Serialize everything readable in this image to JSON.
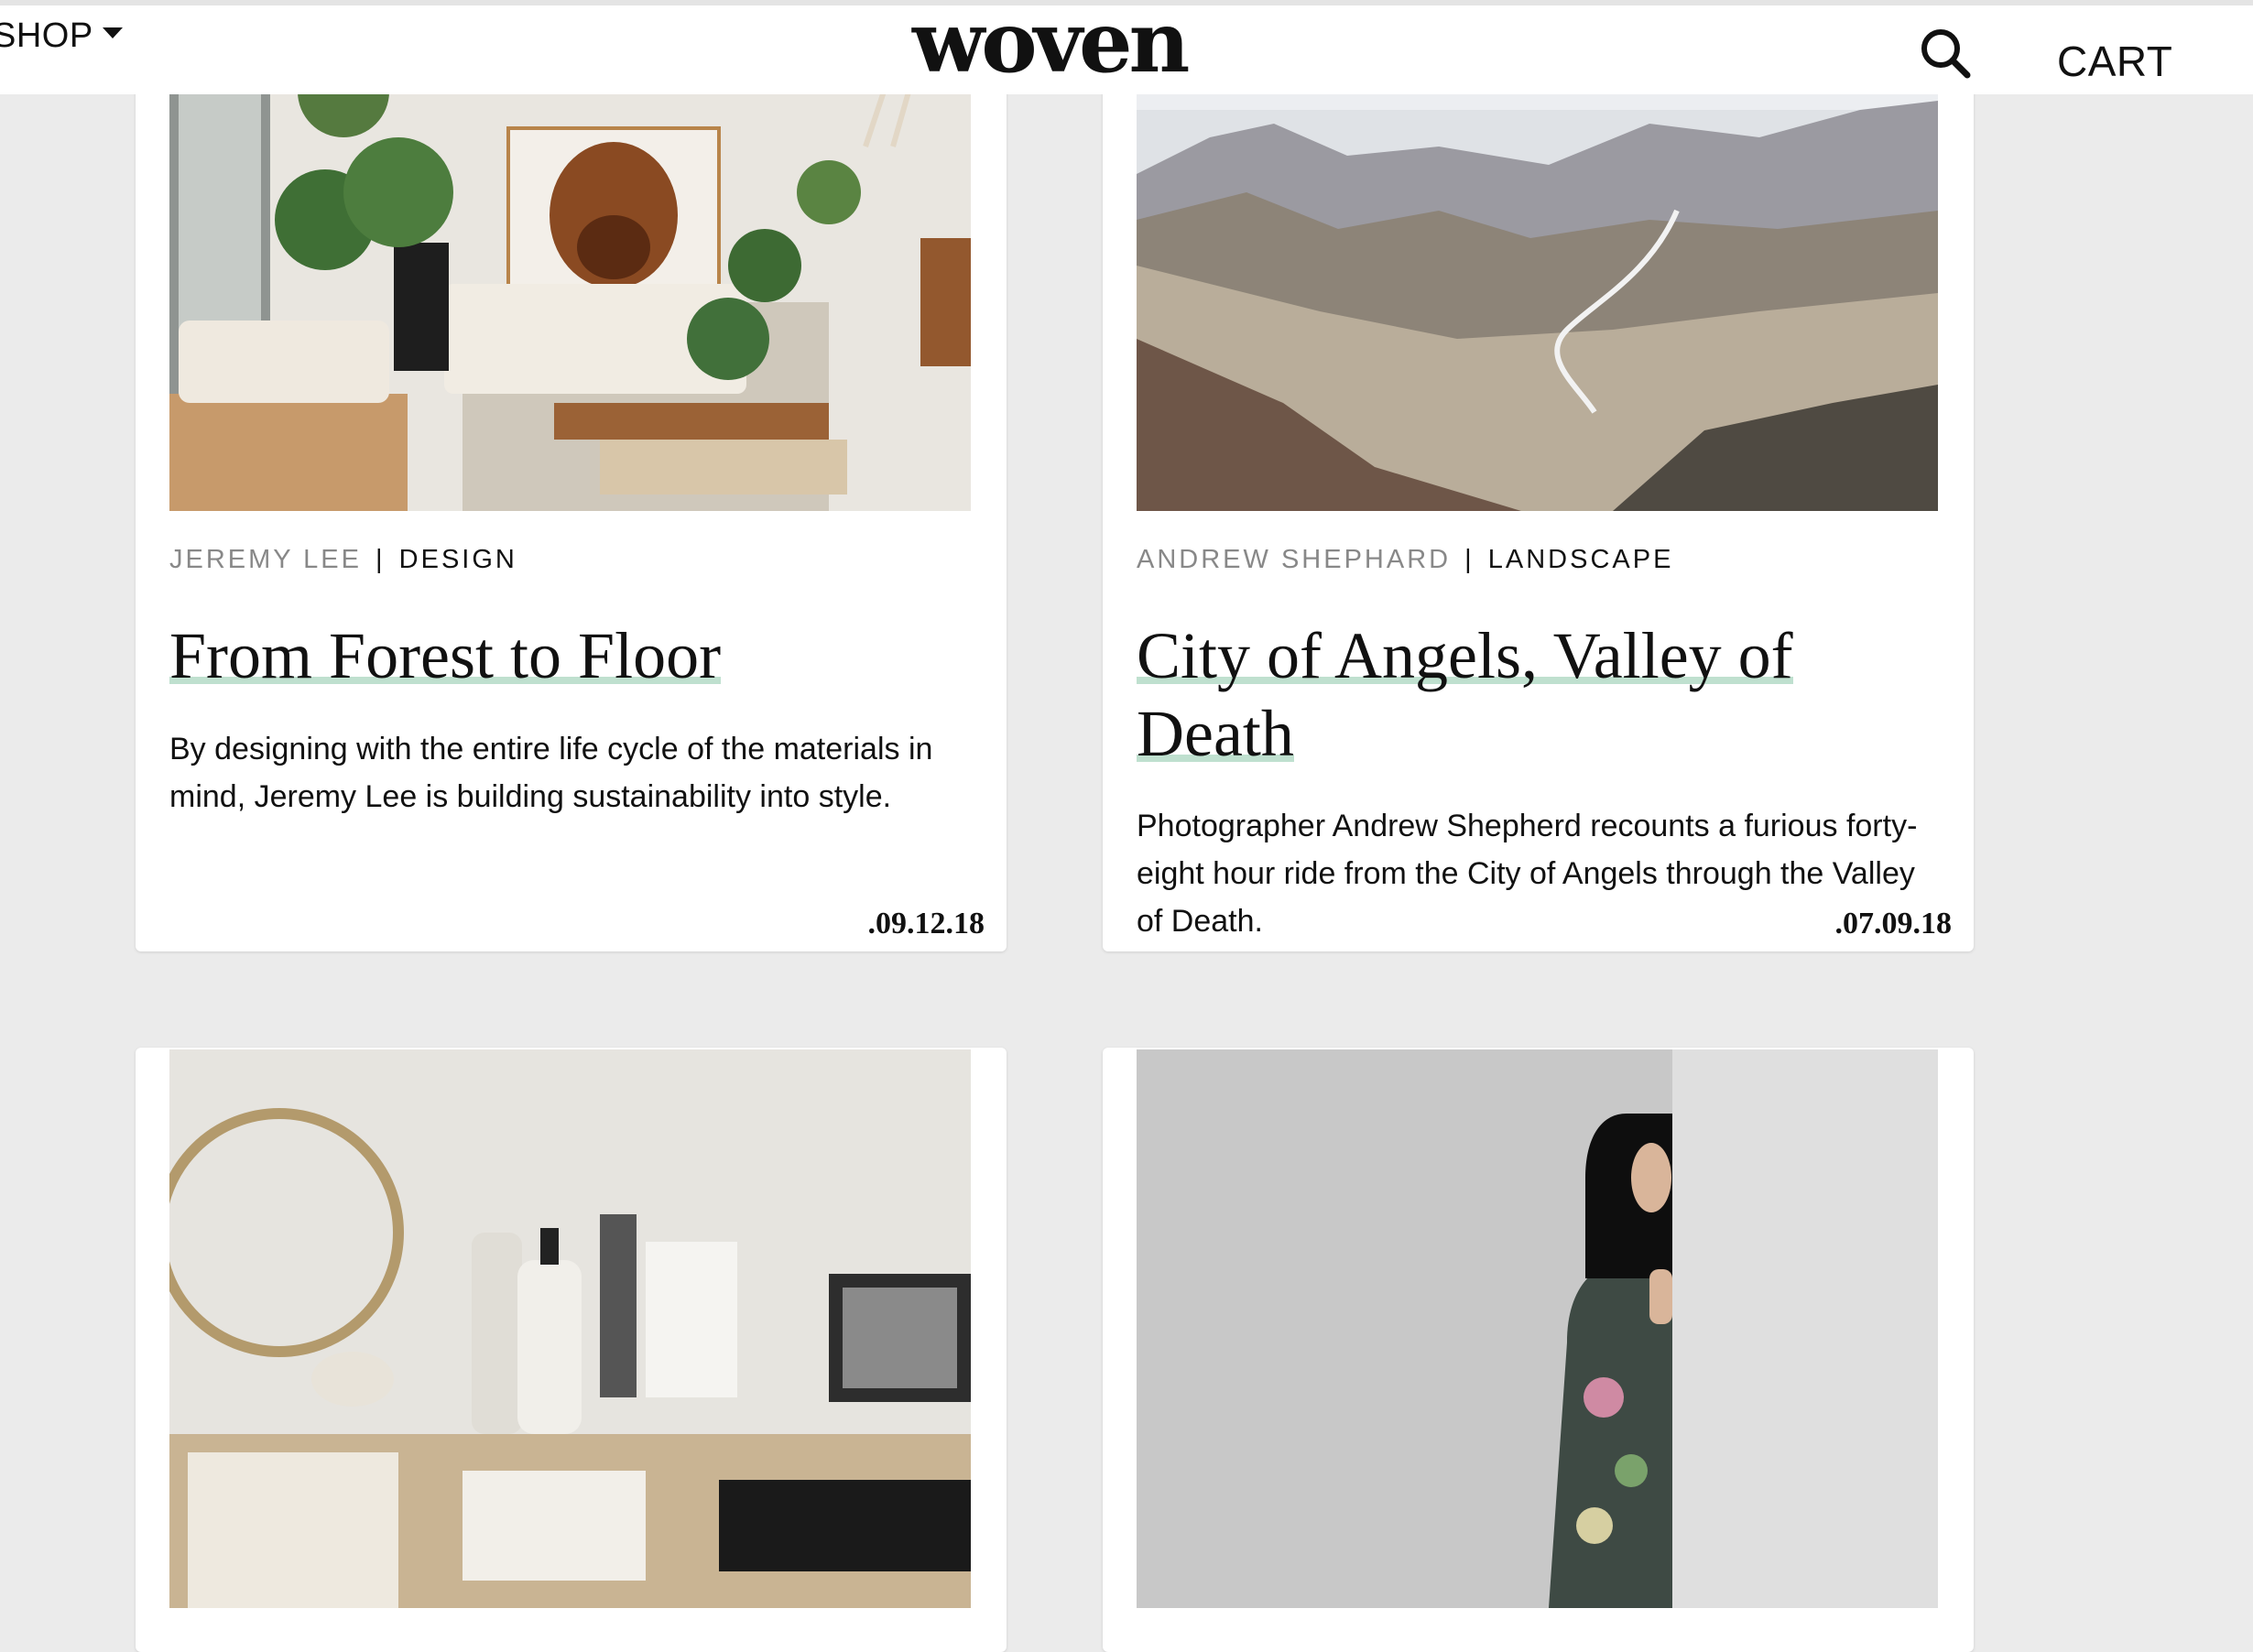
{
  "header": {
    "shop_label": "SHOP",
    "logo": "woven",
    "cart_label": "CART"
  },
  "articles": [
    {
      "author": "JEREMY LEE",
      "separator": "|",
      "category": "DESIGN",
      "title": "From Forest to Floor",
      "excerpt": "By designing with the entire life cycle of the materials in mind, Jeremy Lee is building sustainability into style.",
      "date": ".09.12.18"
    },
    {
      "author": "ANDREW SHEPHARD",
      "separator": "|",
      "category": "LANDSCAPE",
      "title": "City of Angels, Valley of Death",
      "excerpt": "Photographer Andrew Shepherd recounts a furious forty-eight hour ride from the City of Angels through the Valley of Death.",
      "date": ".07.09.18"
    }
  ],
  "colors": {
    "background": "#ebebeb",
    "card": "#ffffff",
    "title_underline": "#bfe0cf",
    "meta_author": "#888888"
  }
}
